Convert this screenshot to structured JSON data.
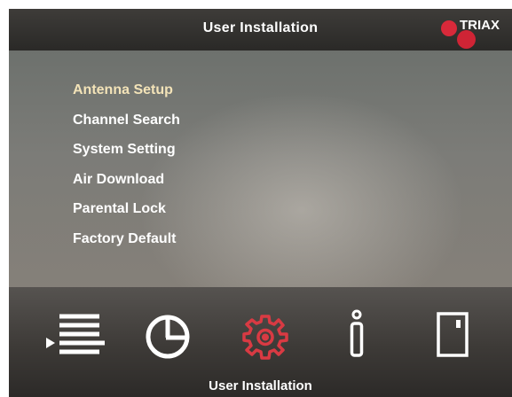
{
  "header": {
    "title": "User Installation"
  },
  "brand": {
    "name": "TRIAX",
    "color": "#d8293a"
  },
  "menu": {
    "selected_index": 0,
    "items": [
      {
        "label": "Antenna Setup"
      },
      {
        "label": "Channel Search"
      },
      {
        "label": "System Setting"
      },
      {
        "label": "Air Download"
      },
      {
        "label": "Parental Lock"
      },
      {
        "label": "Factory Default"
      }
    ]
  },
  "footer": {
    "label": "User Installation",
    "selected_icon": "gear-icon",
    "icons": [
      "channel-list-icon",
      "timer-icon",
      "gear-icon",
      "info-icon",
      "media-card-icon"
    ]
  },
  "colors": {
    "selected_text": "#f3e3b8",
    "selected_icon": "#d93a43",
    "text": "#ffffff"
  }
}
